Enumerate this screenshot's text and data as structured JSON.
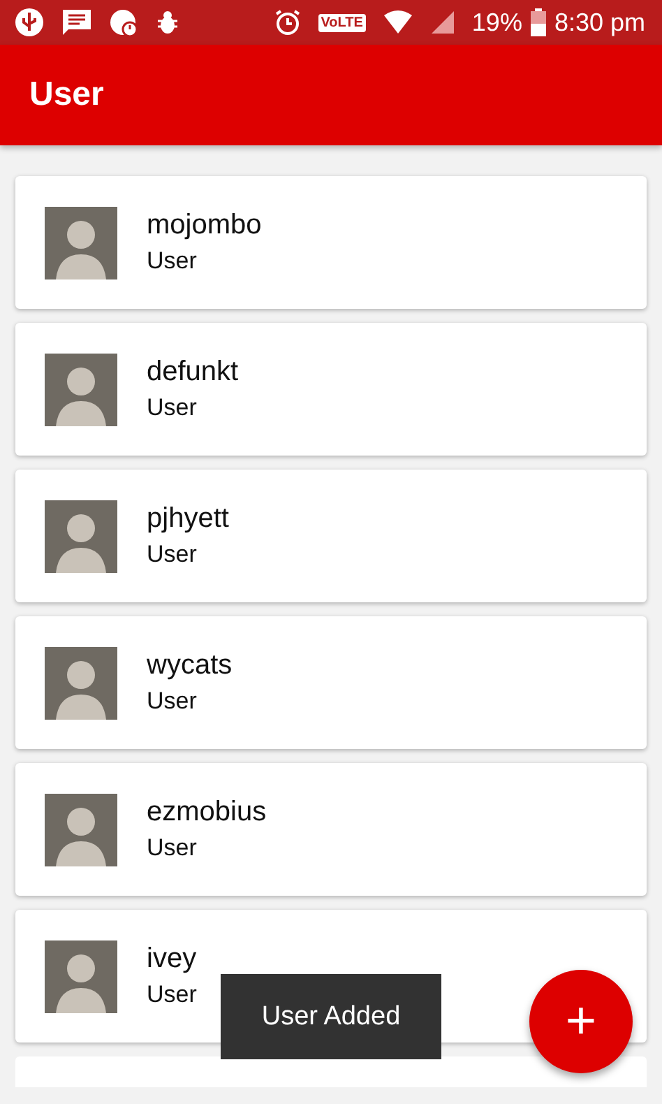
{
  "status_bar": {
    "network_badge": "VoLTE",
    "battery": "19%",
    "time": "8:30 pm"
  },
  "app_bar": {
    "title": "User"
  },
  "users": [
    {
      "name": "mojombo",
      "role": "User"
    },
    {
      "name": "defunkt",
      "role": "User"
    },
    {
      "name": "pjhyett",
      "role": "User"
    },
    {
      "name": "wycats",
      "role": "User"
    },
    {
      "name": "ezmobius",
      "role": "User"
    },
    {
      "name": "ivey",
      "role": "User"
    }
  ],
  "snackbar": {
    "message": "User Added"
  },
  "fab": {
    "label": "+"
  }
}
